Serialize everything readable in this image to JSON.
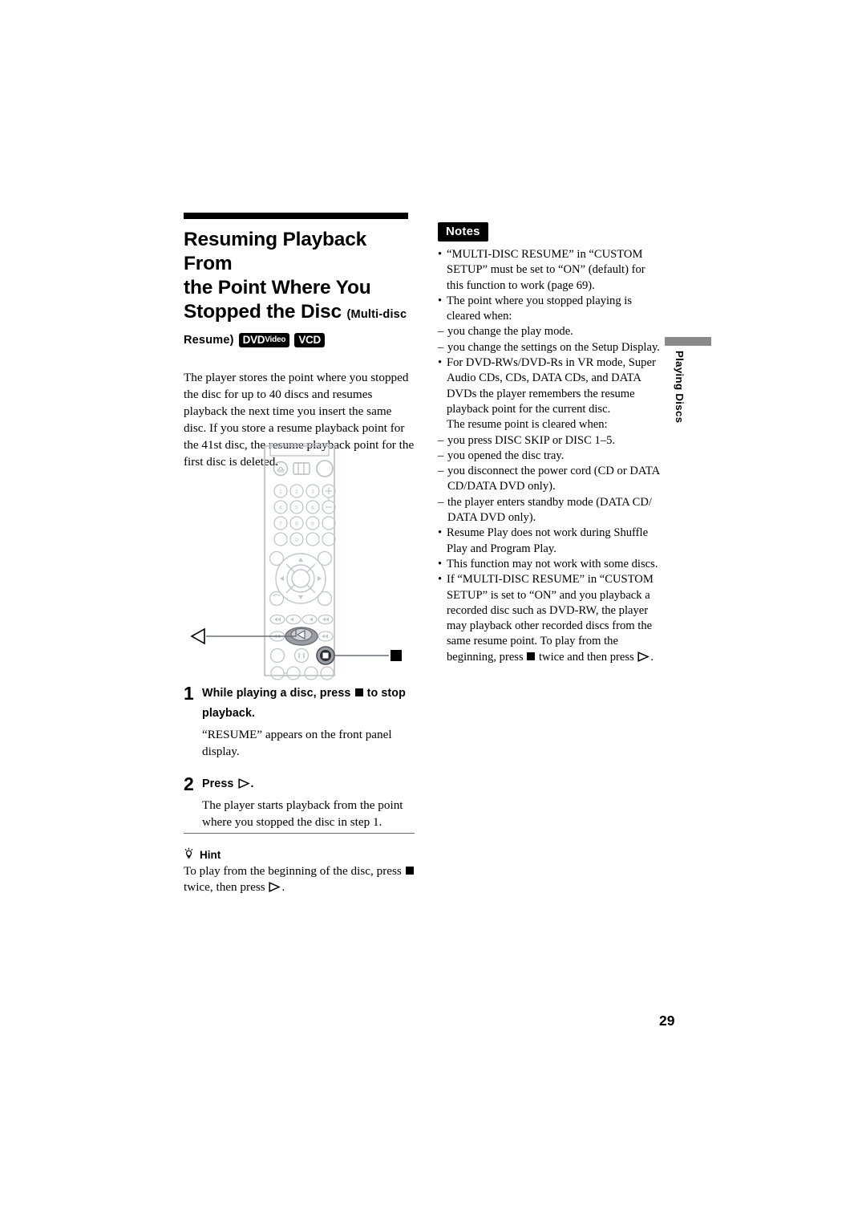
{
  "page": {
    "number": "29",
    "side_tab_label": "Playing Discs"
  },
  "section": {
    "title_line1": "Resuming Playback From",
    "title_line2": "the Point Where You",
    "title_line3": "Stopped the Disc",
    "title_suffix1": "(Multi-disc",
    "title_suffix2": "Resume)",
    "logos": [
      {
        "main": "DVD",
        "small": "Video"
      },
      {
        "main": "VCD",
        "small": ""
      }
    ],
    "intro": "The player stores the point where you stopped the disc for up to 40 discs and resumes playback the next time you insert the same disc. If you store a resume playback point for the 41st disc, the resume playback point for the first disc is deleted."
  },
  "remote": {
    "callout_left_icon": "play-triangle-outline-icon",
    "callout_right_icon": "stop-square-icon",
    "keypad_digits": [
      "1",
      "2",
      "3",
      "4",
      "5",
      "6",
      "7",
      "8",
      "9",
      "0"
    ],
    "top_icons": [
      "eject-icon",
      "display-icon",
      "power-icon"
    ]
  },
  "steps": [
    {
      "number": "1",
      "head_before": "While playing a disc, press",
      "head_glyph": "stop-square-icon",
      "head_after": "to stop playback.",
      "desc": "“RESUME” appears on the front panel display."
    },
    {
      "number": "2",
      "head_before": "Press",
      "head_glyph": "play-triangle-outline-icon",
      "head_after": ".",
      "desc": "The player starts playback from the point where you stopped the disc in step 1."
    }
  ],
  "hint": {
    "icon": "lightbulb-icon",
    "label": "Hint",
    "text_before": "To play from the beginning of the disc, press",
    "glyph1": "stop-square-icon",
    "text_middle": "twice, then press",
    "glyph2": "play-triangle-outline-icon",
    "text_after": "."
  },
  "notes": {
    "badge": "Notes",
    "items": [
      {
        "mark": "•",
        "text": "“MULTI-DISC RESUME” in “CUSTOM SETUP” must be set to “ON” (default) for this function to work (page 69)."
      },
      {
        "mark": "•",
        "text": "The point where you stopped playing is cleared when:"
      },
      {
        "mark": "–",
        "text": "you change the play mode."
      },
      {
        "mark": "–",
        "text": "you change the settings on the Setup Display."
      },
      {
        "mark": "•",
        "text": "For DVD-RWs/DVD-Rs in VR mode, Super Audio CDs, CDs, DATA CDs, and DATA DVDs the player remembers the resume playback point for the current disc."
      },
      {
        "mark": "",
        "text": "The resume point is cleared when:"
      },
      {
        "mark": "–",
        "text": "you press DISC SKIP or DISC 1–5."
      },
      {
        "mark": "–",
        "text": "you opened the disc tray."
      },
      {
        "mark": "–",
        "text": "you disconnect the power cord (CD or DATA CD/DATA DVD only)."
      },
      {
        "mark": "–",
        "text": "the player enters standby mode (DATA CD/ DATA DVD only)."
      },
      {
        "mark": "•",
        "text": "Resume Play does not work during Shuffle Play and Program Play."
      },
      {
        "mark": "•",
        "text": "This function may not work with some discs."
      }
    ],
    "last_item": {
      "mark": "•",
      "text_before": "If “MULTI-DISC RESUME” in “CUSTOM SETUP” is set to “ON” and you playback a recorded disc such as DVD-RW, the player may playback other recorded discs from the same resume point. To play from the beginning, press",
      "glyph1": "stop-square-icon",
      "text_middle": "twice and then press",
      "glyph2": "play-triangle-outline-icon",
      "text_after": "."
    }
  },
  "colors": {
    "rule": "#000000",
    "divider": "#6b6b6b",
    "tab_bar": "#8a8a8a",
    "remote_line": "#b9bcc4"
  }
}
